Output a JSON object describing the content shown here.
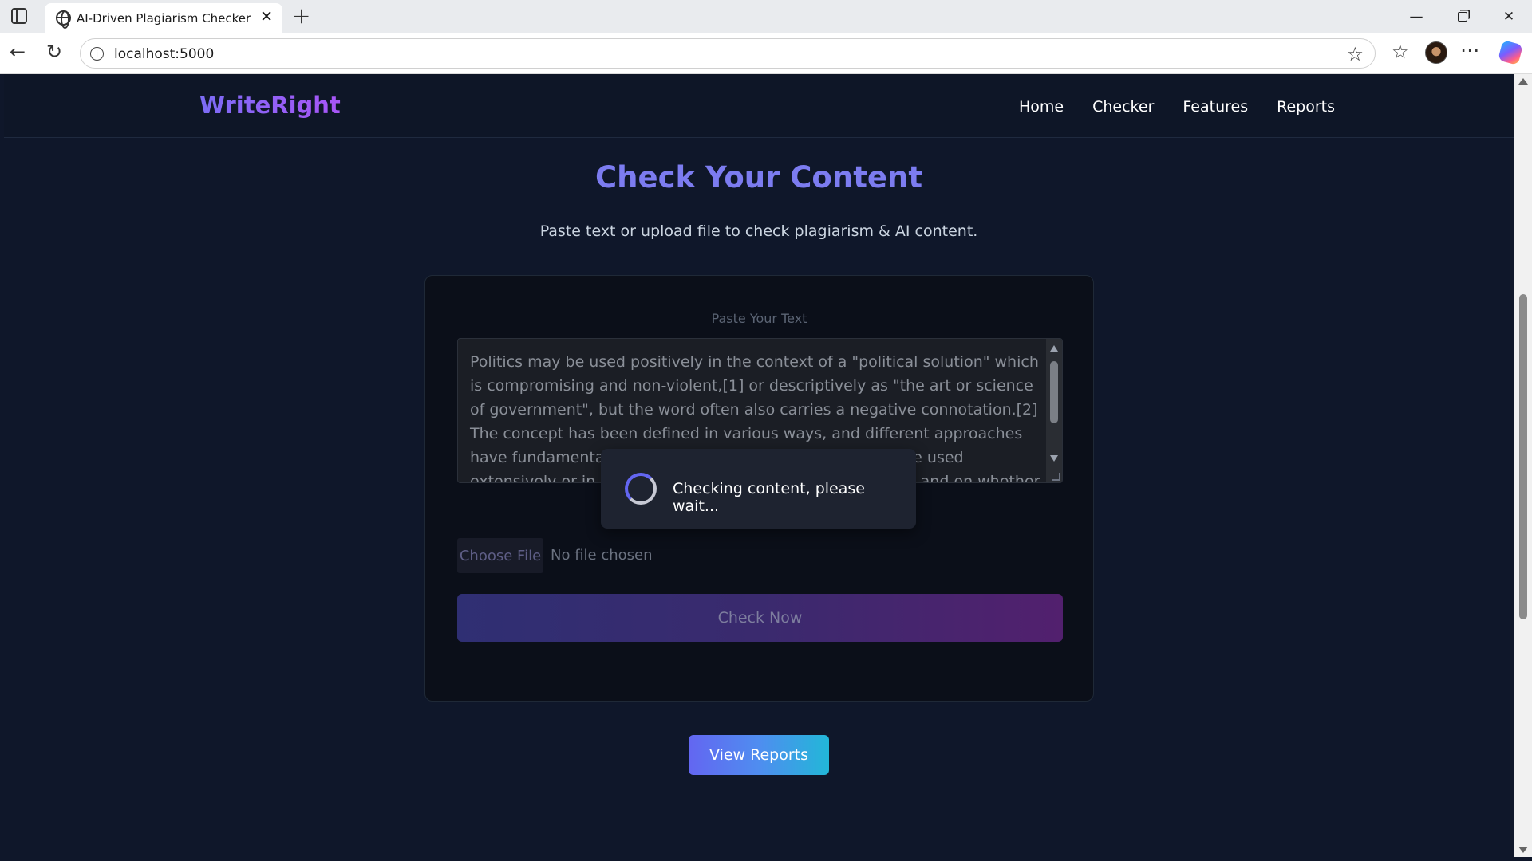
{
  "browser": {
    "tab_title": "AI-Driven Plagiarism Checker",
    "url": "localhost:5000",
    "icons": [
      "sidebar-toggle-icon",
      "globe-icon",
      "close-icon",
      "plus-icon",
      "back-arrow-icon",
      "refresh-icon",
      "info-icon",
      "star-icon",
      "favorites-icon",
      "more-icon",
      "copilot-icon"
    ]
  },
  "site": {
    "logo": "WriteRight",
    "nav": [
      "Home",
      "Checker",
      "Features",
      "Reports"
    ],
    "accent_color": "#7c7cf0"
  },
  "main": {
    "title": "Check Your Content",
    "subtitle": "Paste text or upload file to check plagiarism & AI content.",
    "text_label": "Paste Your Text",
    "text_value": "Politics may be used positively in the context of a \"political solution\" which is compromising and non-violent,[1] or descriptively as \"the art or science of government\", but the word often also carries a negative connotation.[2] The concept has been defined in various ways, and different approaches have fundamentally differing views on whether it should be used extensively or in a limited way, empirically or normatively, and on whether conflict or co-operation",
    "file_button": "Choose File",
    "file_status": "No file chosen",
    "check_button": "Check Now",
    "view_reports_button": "View Reports"
  },
  "overlay": {
    "message": "Checking content, please wait..."
  }
}
